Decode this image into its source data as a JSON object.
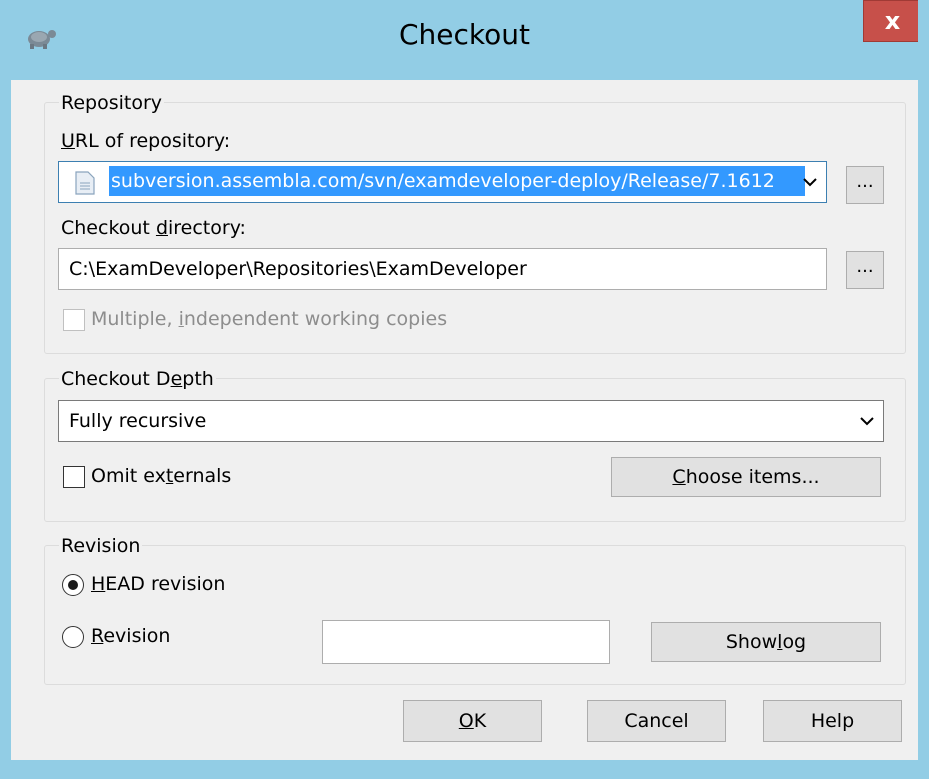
{
  "window": {
    "title": "Checkout",
    "close_label": "x"
  },
  "repository": {
    "group_label": "Repository",
    "url_label": "URL of repository:",
    "url_value": "subversion.assembla.com/svn/examdeveloper-deploy/Release/7.1612",
    "url_browse_label": "...",
    "checkout_dir_label": "Checkout directory:",
    "checkout_dir_value": "C:\\ExamDeveloper\\Repositories\\ExamDeveloper",
    "dir_browse_label": "...",
    "multiple_copies_label": "Multiple, independent working copies"
  },
  "depth": {
    "group_label": "Checkout Depth",
    "selected": "Fully recursive",
    "omit_externals_label": "Omit externals",
    "choose_items_label": "Choose items..."
  },
  "revision": {
    "group_label": "Revision",
    "head_label": "HEAD revision",
    "revision_label": "Revision",
    "revision_value": "",
    "show_log_label": "Show log"
  },
  "buttons": {
    "ok": "OK",
    "cancel": "Cancel",
    "help": "Help"
  },
  "colors": {
    "frame": "#92cde5",
    "close": "#c7504a",
    "selection": "#3399ff"
  }
}
